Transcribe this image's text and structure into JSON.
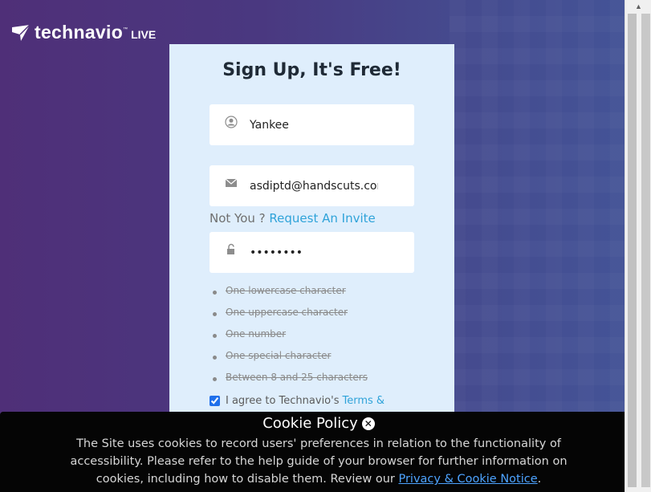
{
  "brand": {
    "name": "technavio",
    "tm": "™",
    "live": "LIVE"
  },
  "form": {
    "title": "Sign Up, It's Free!",
    "name_value": "Yankee",
    "email_value": "asdiptd@handscuts.com",
    "password_value": "password",
    "not_you": "Not You ?",
    "request_invite": "Request An Invite",
    "password_rules": [
      "One lowercase character",
      "One uppercase character",
      "One number",
      "One special character",
      "Between 8 and 25 characters"
    ],
    "agree_text": "I agree to Technavio's",
    "terms_link": "Terms &"
  },
  "cookie": {
    "title": "Cookie Policy",
    "text": "The Site uses cookies to record users' preferences in relation to the functionality of accessibility. Please refer to the help guide of your browser for further information on cookies, including how to disable them. Review our",
    "link": "Privacy & Cookie Notice",
    "end": "."
  },
  "icons": [
    "logo-icon",
    "user-icon",
    "mail-icon",
    "lock-icon",
    "close-icon",
    "scroll-up-icon"
  ]
}
